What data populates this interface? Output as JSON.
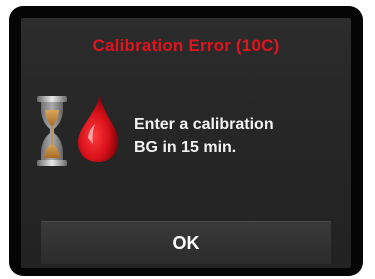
{
  "dialog": {
    "title": "Calibration Error (10C)",
    "message_line1": "Enter a calibration",
    "message_line2": "BG in 15 min.",
    "ok_label": "OK",
    "icons": [
      "hourglass-icon",
      "blood-drop-icon"
    ]
  },
  "colors": {
    "title": "#e0141e",
    "background": "#262626",
    "text": "#f2f2f2",
    "drop": "#d7101a"
  }
}
